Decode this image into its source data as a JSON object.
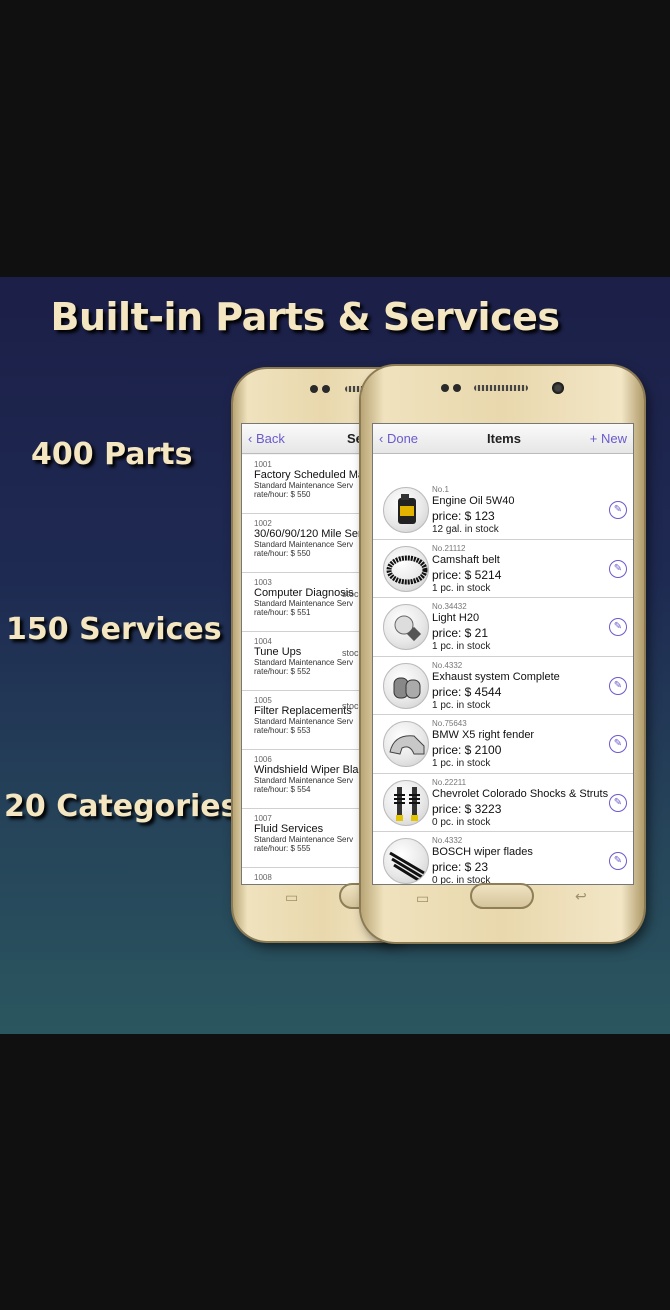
{
  "headline": "Built-in Parts & Services",
  "stats": [
    "400 Parts",
    "150 Services",
    "20 Categories"
  ],
  "services_screen": {
    "back_label": "Back",
    "title_partial": "Se",
    "rows": [
      {
        "code": "1001",
        "name": "Factory Scheduled Ma",
        "category": "Standard Maintenance Serv",
        "rate": "rate/hour: $ 550",
        "stock": ""
      },
      {
        "code": "1002",
        "name": "30/60/90/120 Mile Ser",
        "category": "Standard Maintenance Serv",
        "rate": "rate/hour: $ 550",
        "stock": ""
      },
      {
        "code": "1003",
        "name": "Computer Diagnosis",
        "category": "Standard Maintenance Serv",
        "rate": "rate/hour: $ 551",
        "stock": "stoc"
      },
      {
        "code": "1004",
        "name": "Tune Ups",
        "category": "Standard Maintenance Serv",
        "rate": "rate/hour: $ 552",
        "stock": "stoc"
      },
      {
        "code": "1005",
        "name": "Filter Replacements",
        "category": "Standard Maintenance Serv",
        "rate": "rate/hour: $ 553",
        "stock": "stoc"
      },
      {
        "code": "1006",
        "name": "Windshield Wiper Blad",
        "category": "Standard Maintenance Serv",
        "rate": "rate/hour: $ 554",
        "stock": ""
      },
      {
        "code": "1007",
        "name": "Fluid Services",
        "category": "Standard Maintenance Serv",
        "rate": "rate/hour: $ 555",
        "stock": ""
      },
      {
        "code": "1008",
        "name": "",
        "category": "",
        "rate": "",
        "stock": ""
      }
    ]
  },
  "items_screen": {
    "done_label": "Done",
    "title": "Items",
    "new_label": "New",
    "items": [
      {
        "no": "No.1",
        "name": "Engine Oil 5W40",
        "price": "price: $ 123",
        "stock": "12 gal. in stock",
        "icon": "oil-can-icon"
      },
      {
        "no": "No.21112",
        "name": "Camshaft belt",
        "price": "price: $ 5214",
        "stock": "1 pc. in stock",
        "icon": "belt-icon"
      },
      {
        "no": "No.34432",
        "name": "Light H20",
        "price": "price: $ 21",
        "stock": "1 pc. in stock",
        "icon": "bulb-icon"
      },
      {
        "no": "No.4332",
        "name": "Exhaust system Complete",
        "price": "price: $ 4544",
        "stock": "1 pc. in stock",
        "icon": "exhaust-icon"
      },
      {
        "no": "No.75643",
        "name": "BMW X5 right fender",
        "price": "price: $ 2100",
        "stock": "1 pc. in stock",
        "icon": "fender-icon"
      },
      {
        "no": "No.22211",
        "name": "Chevrolet Colorado Shocks & Struts",
        "price": "price: $ 3223",
        "stock": "0 pc. in stock",
        "icon": "shocks-icon"
      },
      {
        "no": "No.4332",
        "name": "BOSCH wiper flades",
        "price": "price: $ 23",
        "stock": "0 pc. in stock",
        "icon": "wiper-icon"
      }
    ]
  }
}
